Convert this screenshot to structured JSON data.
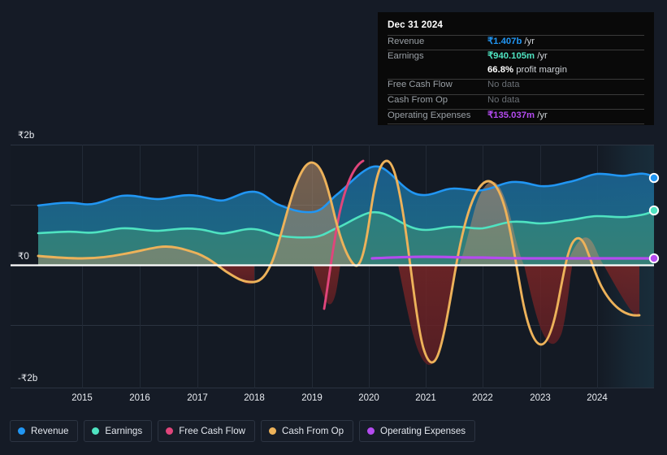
{
  "tooltip": {
    "date": "Dec 31 2024",
    "rows": [
      {
        "key": "Revenue",
        "value": "₹1.407b",
        "unit": "/yr",
        "color": "#2196f3",
        "nodata": false
      },
      {
        "key": "Earnings",
        "value": "₹940.105m",
        "unit": "/yr",
        "color": "#4fe3c1",
        "nodata": false
      },
      {
        "key": "Free Cash Flow",
        "value": "No data",
        "unit": "",
        "color": "#6a6f75",
        "nodata": true
      },
      {
        "key": "Cash From Op",
        "value": "No data",
        "unit": "",
        "color": "#6a6f75",
        "nodata": true
      },
      {
        "key": "Operating Expenses",
        "value": "₹135.037m",
        "unit": "/yr",
        "color": "#b44bf0",
        "nodata": false
      }
    ],
    "margin_pct": "66.8%",
    "margin_label": "profit margin"
  },
  "legend": [
    {
      "label": "Revenue",
      "color": "#2196f3"
    },
    {
      "label": "Earnings",
      "color": "#4fe3c1"
    },
    {
      "label": "Free Cash Flow",
      "color": "#e0457b"
    },
    {
      "label": "Cash From Op",
      "color": "#edb25a"
    },
    {
      "label": "Operating Expenses",
      "color": "#b44bf0"
    }
  ],
  "chart_data": {
    "type": "area",
    "title": "",
    "xlabel": "",
    "ylabel": "",
    "ylim": [
      -2000000000,
      2000000000
    ],
    "ytick_labels": [
      "₹2b",
      "₹0",
      "-₹2b"
    ],
    "ytick_values": [
      2000000000,
      0,
      -2000000000
    ],
    "xtick_labels": [
      "2015",
      "2016",
      "2017",
      "2018",
      "2019",
      "2020",
      "2021",
      "2022",
      "2023",
      "2024"
    ],
    "grid": true,
    "legend_position": "bottom",
    "currency": "INR",
    "forecast_start_label": "2024",
    "x": [
      2014.3,
      2014.6,
      2015.0,
      2015.4,
      2015.8,
      2016.2,
      2016.6,
      2017.0,
      2017.4,
      2017.8,
      2018.2,
      2018.6,
      2019.0,
      2019.4,
      2019.8,
      2020.2,
      2020.6,
      2021.0,
      2021.4,
      2021.8,
      2022.2,
      2022.6,
      2023.0,
      2023.4,
      2023.8,
      2024.2,
      2024.6,
      2025.0
    ],
    "series": [
      {
        "name": "Revenue",
        "color": "#2196f3",
        "unit": "INR",
        "values": [
          1060000000,
          1030000000,
          1060000000,
          1090000000,
          1070000000,
          1110000000,
          1090000000,
          1130000000,
          1110000000,
          1070000000,
          990000000,
          960000000,
          1020000000,
          1190000000,
          1310000000,
          1400000000,
          1280000000,
          1170000000,
          1200000000,
          1190000000,
          1290000000,
          1280000000,
          1270000000,
          1290000000,
          1330000000,
          1340000000,
          1390000000,
          1407000000
        ]
      },
      {
        "name": "Earnings",
        "color": "#4fe3c1",
        "unit": "INR",
        "values": [
          600000000,
          580000000,
          610000000,
          620000000,
          600000000,
          625000000,
          610000000,
          620000000,
          600000000,
          580000000,
          560000000,
          560000000,
          600000000,
          700000000,
          790000000,
          850000000,
          790000000,
          730000000,
          760000000,
          750000000,
          840000000,
          820000000,
          820000000,
          830000000,
          860000000,
          850000000,
          900000000,
          940105000
        ]
      },
      {
        "name": "Free Cash Flow",
        "color": "#e0457b",
        "unit": "INR",
        "values": [
          null,
          null,
          null,
          null,
          null,
          null,
          null,
          null,
          null,
          null,
          null,
          null,
          null,
          -600000000,
          500000000,
          1500000000,
          null,
          null,
          null,
          null,
          null,
          null,
          null,
          null,
          null,
          null,
          null,
          null
        ]
      },
      {
        "name": "Cash From Op",
        "color": "#edb25a",
        "unit": "INR",
        "values": [
          40000000,
          30000000,
          20000000,
          20000000,
          30000000,
          60000000,
          100000000,
          130000000,
          160000000,
          120000000,
          30000000,
          -120000000,
          -160000000,
          -120000000,
          600000000,
          1520000000,
          900000000,
          -1000000000,
          -1880000000,
          -700000000,
          1420000000,
          900000000,
          -900000000,
          -1630000000,
          250000000,
          830000000,
          200000000,
          -620000000
        ]
      },
      {
        "name": "Operating Expenses",
        "color": "#b44bf0",
        "unit": "INR",
        "values": [
          null,
          null,
          null,
          null,
          null,
          null,
          null,
          null,
          null,
          null,
          null,
          null,
          null,
          null,
          null,
          140000000,
          135000000,
          130000000,
          135000000,
          130000000,
          128000000,
          130000000,
          132000000,
          130000000,
          133000000,
          134000000,
          135000000,
          135037000
        ]
      }
    ]
  }
}
